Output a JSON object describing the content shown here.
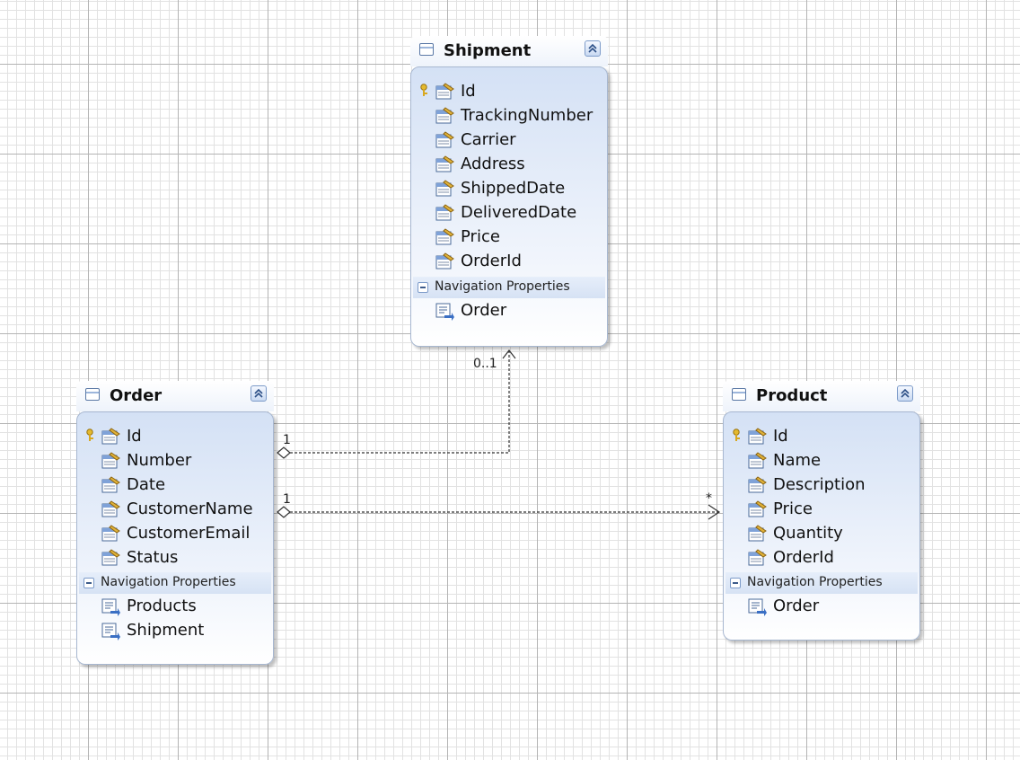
{
  "entities": {
    "shipment": {
      "title": "Shipment",
      "key_property": "Id",
      "properties": [
        "Id",
        "TrackingNumber",
        "Carrier",
        "Address",
        "ShippedDate",
        "DeliveredDate",
        "Price",
        "OrderId"
      ],
      "nav_section_label": "Navigation Properties",
      "nav_properties": [
        "Order"
      ]
    },
    "order": {
      "title": "Order",
      "key_property": "Id",
      "properties": [
        "Id",
        "Number",
        "Date",
        "CustomerName",
        "CustomerEmail",
        "Status"
      ],
      "nav_section_label": "Navigation Properties",
      "nav_properties": [
        "Products",
        "Shipment"
      ]
    },
    "product": {
      "title": "Product",
      "key_property": "Id",
      "properties": [
        "Id",
        "Name",
        "Description",
        "Price",
        "Quantity",
        "OrderId"
      ],
      "nav_section_label": "Navigation Properties",
      "nav_properties": [
        "Order"
      ]
    }
  },
  "associations": [
    {
      "from": "Order",
      "to": "Shipment",
      "from_multiplicity": "1",
      "to_multiplicity": "0..1"
    },
    {
      "from": "Order",
      "to": "Product",
      "from_multiplicity": "1",
      "to_multiplicity": "*"
    }
  ],
  "icons": {
    "entity": "table-icon",
    "collapse": "collapse-up-icon",
    "key": "key-icon",
    "property": "property-icon",
    "navigation": "navigation-property-icon",
    "section_toggle": "minus-icon"
  },
  "colors": {
    "grid_major": "#b4b4b4",
    "grid_minor": "#e2e2e2",
    "entity_body_top": "#d4e1f5",
    "entity_border": "#a7b7d0",
    "key_gold": "#d8a820",
    "accent_blue": "#3a6fc4"
  }
}
